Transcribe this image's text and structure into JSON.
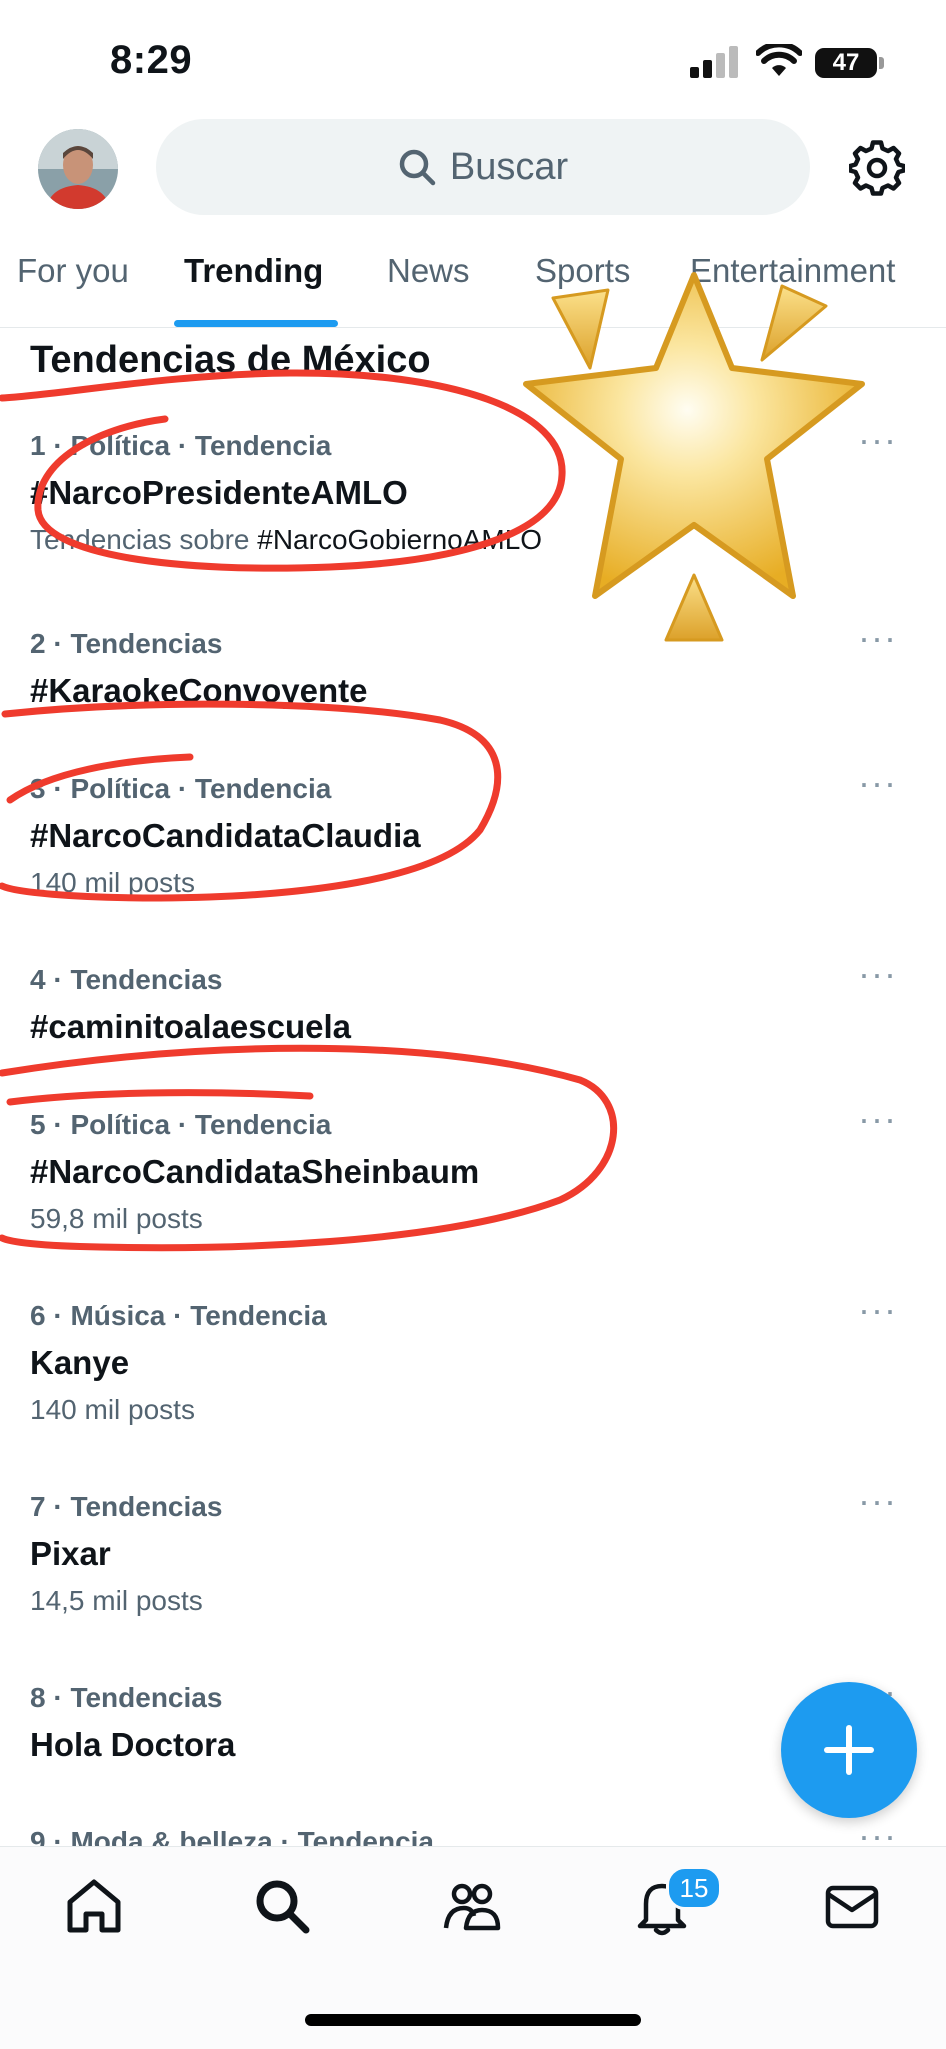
{
  "status_bar": {
    "time": "8:29",
    "battery": "47"
  },
  "search": {
    "placeholder": "Buscar"
  },
  "tabs": [
    {
      "label": "For you"
    },
    {
      "label": "Trending"
    },
    {
      "label": "News"
    },
    {
      "label": "Sports"
    },
    {
      "label": "Entertainment"
    }
  ],
  "section_title": "Tendencias de México",
  "trends": [
    {
      "meta": "1 · Política · Tendencia",
      "name": "#NarcoPresidenteAMLO",
      "sub_prefix": "Tendencias sobre ",
      "sub_tag": "#NarcoGobiernoAMLO"
    },
    {
      "meta": "2 · Tendencias",
      "name": "#KaraokeConvoyente"
    },
    {
      "meta": "3 · Política · Tendencia",
      "name": "#NarcoCandidataClaudia",
      "sub": "140 mil posts"
    },
    {
      "meta": "4 · Tendencias",
      "name": "#caminitoalaescuela"
    },
    {
      "meta": "5 · Política · Tendencia",
      "name": "#NarcoCandidataSheinbaum",
      "sub": "59,8 mil posts"
    },
    {
      "meta": "6 · Música · Tendencia",
      "name": "Kanye",
      "sub": "140 mil posts"
    },
    {
      "meta": "7 · Tendencias",
      "name": "Pixar",
      "sub": "14,5 mil posts"
    },
    {
      "meta": "8 · Tendencias",
      "name": "Hola Doctora"
    },
    {
      "meta": "9 · Moda & belleza · Tendencia"
    }
  ],
  "notifications_badge": "15",
  "icons": [
    "home-icon",
    "search-icon",
    "communities-icon",
    "bell-icon",
    "mail-icon",
    "gear-icon",
    "plus-icon",
    "sparkle-star-icon"
  ],
  "colors": {
    "accent": "#1d9bf0",
    "annotation": "#ef3b2d",
    "star": "#f2c33e"
  }
}
